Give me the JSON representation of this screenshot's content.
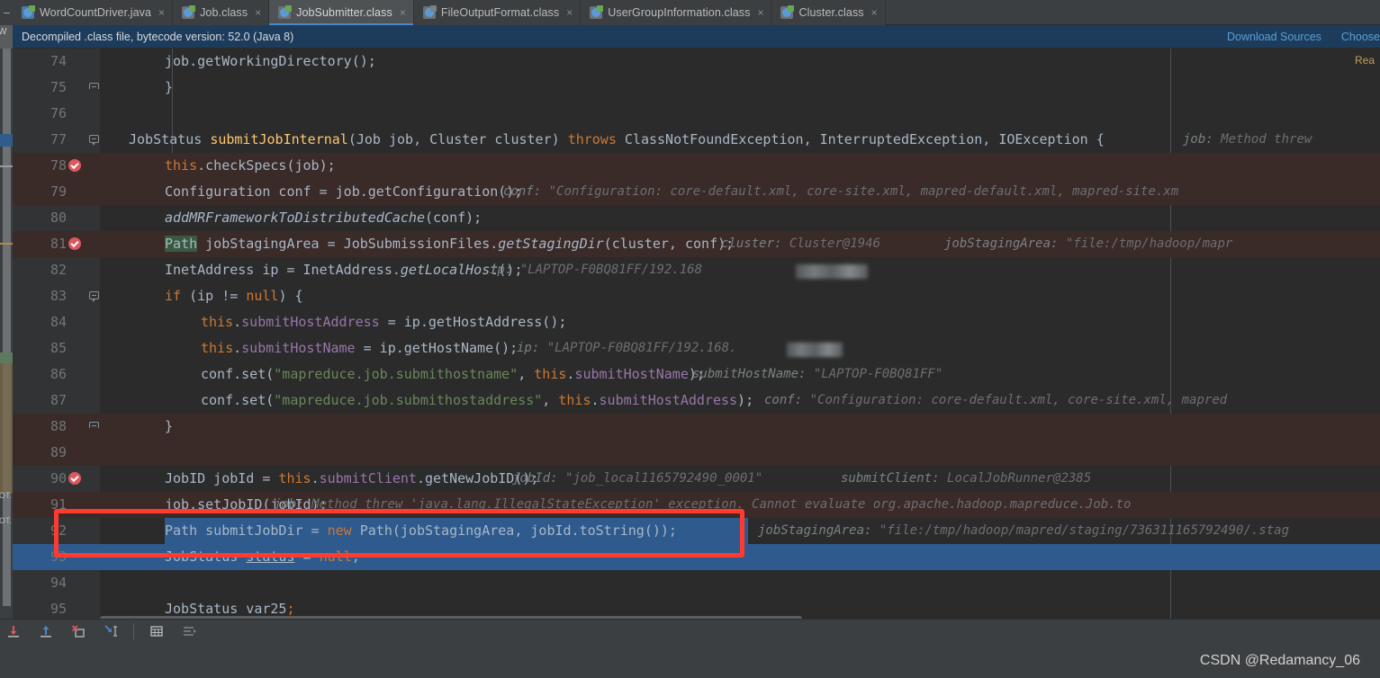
{
  "tabs": [
    {
      "label": "WordCountDriver.java",
      "icon": "java-file-icon",
      "active": false
    },
    {
      "label": "Job.class",
      "icon": "class-file-icon",
      "active": false
    },
    {
      "label": "JobSubmitter.class",
      "icon": "class-file-icon",
      "active": true
    },
    {
      "label": "FileOutputFormat.class",
      "icon": "class-file-icon",
      "active": false
    },
    {
      "label": "UserGroupInformation.class",
      "icon": "class-file-icon",
      "active": false
    },
    {
      "label": "Cluster.class",
      "icon": "class-file-icon",
      "active": false
    }
  ],
  "tab_close_glyph": "×",
  "notification": {
    "message": "Decompiled .class file, bytecode version: 52.0 (Java 8)",
    "links": [
      {
        "label": "Download Sources"
      },
      {
        "label": "Choose"
      }
    ],
    "side_label": "W"
  },
  "editor": {
    "readonly_label": "Rea",
    "lines": [
      {
        "no": "74",
        "indent": 6,
        "tokens": [
          {
            "t": "job.getWorkingDirectory",
            "c": "plain"
          },
          {
            "t": "();",
            "c": "plain"
          }
        ],
        "plain": "job.getWorkingDirectory();"
      },
      {
        "no": "75",
        "indent": 2,
        "plain": "}"
      },
      {
        "no": "76",
        "indent": 0,
        "plain": ""
      },
      {
        "no": "77",
        "indent": 2,
        "plain": "JobStatus submitJobInternal(Job job, Cluster cluster) throws ClassNotFoundException, InterruptedException, IOException {",
        "hint_name": "job:",
        "hint_value": "Method threw"
      },
      {
        "no": "78",
        "indent": 4,
        "plain": "this.checkSpecs(job);",
        "breakpoint": true
      },
      {
        "no": "79",
        "indent": 4,
        "plain": "Configuration conf = job.getConfiguration();",
        "hint_name": "conf:",
        "hint_value": "\"Configuration: core-default.xml, core-site.xml, mapred-default.xml, mapred-site.xm"
      },
      {
        "no": "80",
        "indent": 4,
        "plain": "addMRFrameworkToDistributedCache(conf);"
      },
      {
        "no": "81",
        "indent": 4,
        "plain": "Path jobStagingArea = JobSubmissionFiles.getStagingDir(cluster, conf);",
        "breakpoint": true,
        "hint_name": "cluster:",
        "hint_value": "Cluster@1946",
        "hint2_name": "jobStagingArea:",
        "hint2_value": "\"file:/tmp/hadoop/mapr"
      },
      {
        "no": "82",
        "indent": 4,
        "plain": "InetAddress ip = InetAddress.getLocalHost();",
        "hint_name": "ip:",
        "hint_value": "\"LAPTOP-F0BQ81FF/192.168"
      },
      {
        "no": "83",
        "indent": 4,
        "plain": "if (ip != null) {"
      },
      {
        "no": "84",
        "indent": 6,
        "plain": "this.submitHostAddress = ip.getHostAddress();"
      },
      {
        "no": "85",
        "indent": 6,
        "plain": "this.submitHostName = ip.getHostName();",
        "hint_name": "ip:",
        "hint_value": "\"LAPTOP-F0BQ81FF/192.168."
      },
      {
        "no": "86",
        "indent": 6,
        "plain": "conf.set(\"mapreduce.job.submithostname\", this.submitHostName);",
        "hint_name": "submitHostName:",
        "hint_value": "\"LAPTOP-F0BQ81FF\""
      },
      {
        "no": "87",
        "indent": 6,
        "plain": "conf.set(\"mapreduce.job.submithostaddress\", this.submitHostAddress);",
        "hint_name": "conf:",
        "hint_value": "\"Configuration: core-default.xml, core-site.xml, mapred"
      },
      {
        "no": "88",
        "indent": 4,
        "plain": "}"
      },
      {
        "no": "89",
        "indent": 0,
        "plain": ""
      },
      {
        "no": "90",
        "indent": 4,
        "plain": "JobID jobId = this.submitClient.getNewJobID();",
        "breakpoint": true,
        "hint_name": "jobId:",
        "hint_value": "\"job_local1165792490_0001\"",
        "hint2_name": "submitClient:",
        "hint2_value": "LocalJobRunner@2385"
      },
      {
        "no": "91",
        "indent": 4,
        "plain": "job.setJobID(jobId);",
        "hint_name": "job:",
        "hint_value": "Method threw 'java.lang.IllegalStateException' exception. Cannot evaluate org.apache.hadoop.mapreduce.Job.to"
      },
      {
        "no": "92",
        "indent": 4,
        "plain": "Path submitJobDir = new Path(jobStagingArea, jobId.toString());",
        "selected": true,
        "hint_name": "jobStagingArea:",
        "hint_value": "\"file:/tmp/hadoop/mapred/staging/736311165792490/.stag"
      },
      {
        "no": "93",
        "indent": 4,
        "plain": "JobStatus status = null;",
        "selected_row": true
      },
      {
        "no": "94",
        "indent": 0,
        "plain": ""
      },
      {
        "no": "95",
        "indent": 4,
        "plain": "JobStatus var25;"
      }
    ]
  },
  "left_strip": {
    "markers": [
      "OT.",
      "OT."
    ]
  },
  "toolbar": {
    "buttons": [
      {
        "name": "step-into-icon",
        "label": "Step Into"
      },
      {
        "name": "step-out-icon",
        "label": "Step Out"
      },
      {
        "name": "force-step-over-icon",
        "label": "Force Step Over"
      },
      {
        "name": "run-to-cursor-icon",
        "label": "Run to Cursor"
      },
      {
        "name": "evaluate-expression-icon",
        "label": "Evaluate Expression"
      },
      {
        "name": "show-frames-icon",
        "label": "Show Execution Point"
      }
    ]
  },
  "status": {
    "watermark": "CSDN @Redamancy_06"
  },
  "colors": {
    "accent": "#4a88c7",
    "notification_bg": "#1d3c5c",
    "link": "#5a9fd4",
    "editor_bg": "#2b2b2b",
    "gutter_bg": "#313335",
    "selection": "#2e5a8e",
    "exec_line": "#3a2a28",
    "annotation": "#ff3b30",
    "breakpoint": "#db5860",
    "keyword": "#cc7832",
    "string": "#6a8759",
    "field": "#9876aa",
    "method_decl": "#ffc66d",
    "number": "#6897bb",
    "text": "#a9b7c6",
    "hint": "#6c6f70"
  }
}
